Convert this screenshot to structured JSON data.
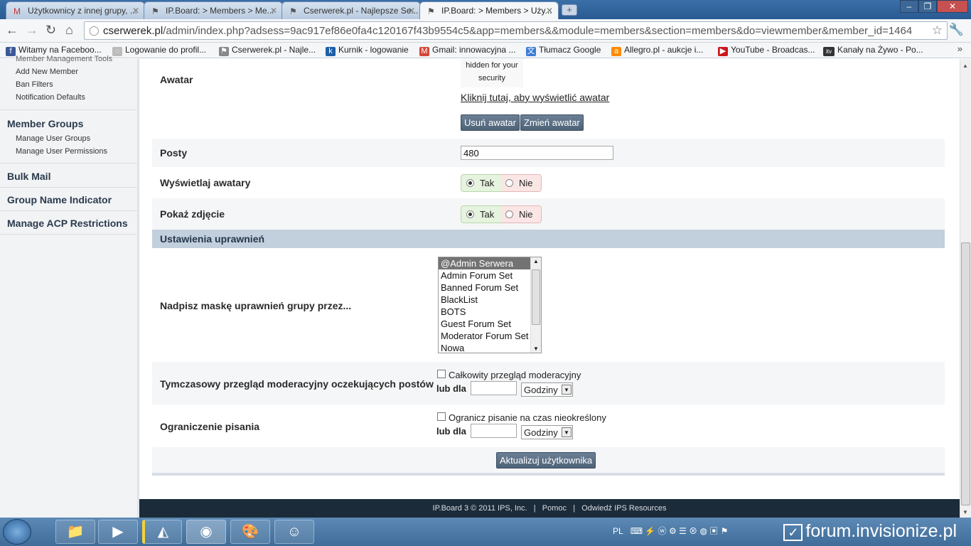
{
  "browser": {
    "tabs": [
      {
        "title": "Użytkownicy z innej grupy, ..."
      },
      {
        "title": "IP.Board: > Members > Me..."
      },
      {
        "title": "Cserwerek.pl - Najlepsze Se..."
      },
      {
        "title": "IP.Board: > Members > Uży..."
      }
    ],
    "url_host": "cserwerek.pl",
    "url_path": "/admin/index.php?adsess=9ac917ef86e0fa4c120167f43b9554c5&app=members&&module=members&section=members&do=viewmember&member_id=1464",
    "bookmarks": [
      {
        "label": "Witamy na Faceboo...",
        "color": "#3b5998",
        "icon": "f"
      },
      {
        "label": "Logowanie do profil...",
        "color": "#999999",
        "icon": "◌"
      },
      {
        "label": "Cserwerek.pl - Najle...",
        "color": "#888888",
        "icon": "⚑"
      },
      {
        "label": "Kurnik - logowanie",
        "color": "#1d5fa8",
        "icon": "k"
      },
      {
        "label": "Gmail: innowacyjna ...",
        "color": "#d44638",
        "icon": "M"
      },
      {
        "label": "Tłumacz Google",
        "color": "#3a7bd5",
        "icon": "文"
      },
      {
        "label": "Allegro.pl - aukcje i...",
        "color": "#ff8a00",
        "icon": "a"
      },
      {
        "label": "YouTube - Broadcas...",
        "color": "#cc181e",
        "icon": "▶"
      },
      {
        "label": "Kanały na Żywo - Po...",
        "color": "#333333",
        "icon": "itv"
      }
    ]
  },
  "sidebar": {
    "top_items": [
      "Member Management Tools",
      "Add New Member",
      "Ban Filters",
      "Notification Defaults"
    ],
    "member_groups": "Member Groups",
    "group_items": [
      "Manage User Groups",
      "Manage User Permissions"
    ],
    "bulk_mail": "Bulk Mail",
    "group_name_indicator": "Group Name Indicator",
    "acp_restrictions": "Manage ACP Restrictions"
  },
  "form": {
    "avatar_label": "Awatar",
    "avatar_hidden_1": "hidden for your",
    "avatar_hidden_2": "security",
    "avatar_link": "Kliknij tutaj, aby wyświetlić awatar",
    "remove_avatar": "Usuń awatar",
    "change_avatar": "Zmień awatar",
    "posts_label": "Posty",
    "posts_value": "480",
    "show_avatars_label": "Wyświetlaj awatary",
    "show_photo_label": "Pokaż zdjęcie",
    "yes": "Tak",
    "no": "Nie",
    "permissions_header": "Ustawienia uprawnień",
    "override_mask_label": "Nadpisz maskę uprawnień grupy przez...",
    "mask_options": [
      "@Admin Serwera",
      "Admin Forum Set",
      "Banned Forum Set",
      "BlackList",
      "BOTS",
      "Guest Forum Set",
      "Moderator Forum Set",
      "Nowa"
    ],
    "mod_review_label": "Tymczasowy przegląd moderacyjny oczekujących postów",
    "mod_review_check": "Całkowity przegląd moderacyjny",
    "or_for": "lub dla",
    "hours": "Godziny",
    "posting_limit_label": "Ograniczenie pisania",
    "posting_limit_check": "Ogranicz pisanie na czas nieokreślony",
    "update_button": "Aktualizuj użytkownika"
  },
  "footer": {
    "copyright": "IP.Board 3 © 2011 IPS, Inc.",
    "help": "Pomoc",
    "visit": "Odwiedź IPS Resources",
    "sep": "|"
  },
  "taskbar": {
    "lang": "PL",
    "watermark": "forum.invisionize.pl"
  }
}
